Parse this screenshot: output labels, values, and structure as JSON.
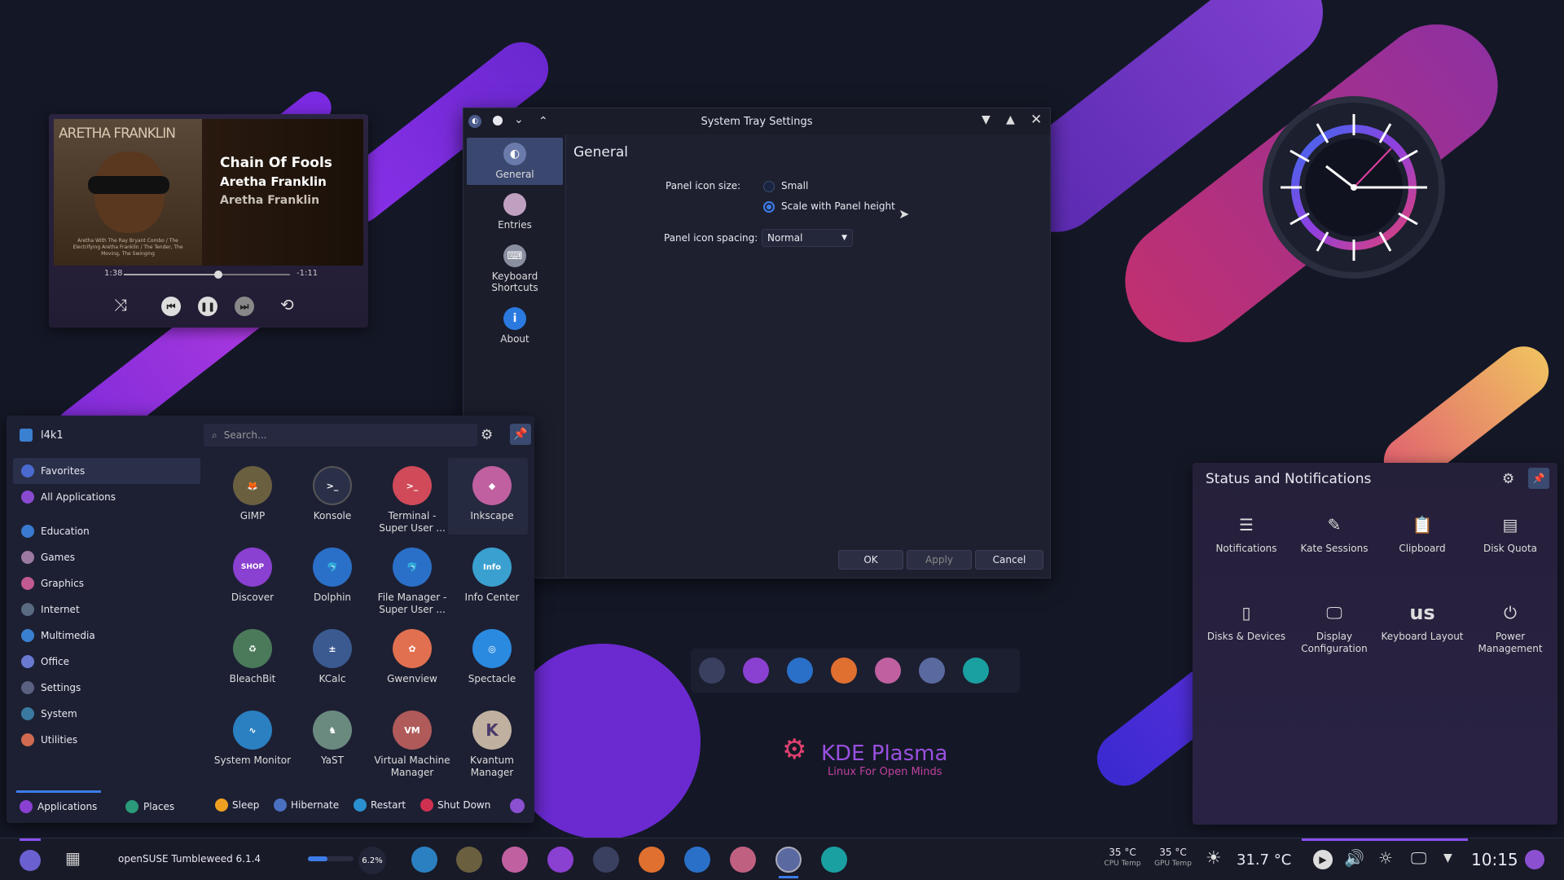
{
  "player": {
    "album_text": "ARETHA FRANKLIN",
    "title": "Chain Of Fools",
    "artist": "Aretha Franklin",
    "album": "Aretha Franklin",
    "elapsed": "1:38",
    "remaining": "-1:11",
    "progress": 0.57,
    "cover_caption": "Aretha With The Ray Bryant Combo / The Electrifying Aretha Franklin / The Tender, The Moving, The Swinging"
  },
  "window": {
    "title": "System Tray Settings",
    "sidebar": [
      {
        "label": "General",
        "icon": "general-icon"
      },
      {
        "label": "Entries",
        "icon": "entries-icon"
      },
      {
        "label": "Keyboard Shortcuts",
        "icon": "keyboard-icon"
      },
      {
        "label": "About",
        "icon": "about-icon"
      }
    ],
    "heading": "General",
    "icon_size_label": "Panel icon size:",
    "icon_size_options": [
      "Small",
      "Scale with Panel height"
    ],
    "icon_size_selected": "Scale with Panel height",
    "spacing_label": "Panel icon spacing:",
    "spacing_value": "Normal",
    "ok": "OK",
    "apply": "Apply",
    "cancel": "Cancel"
  },
  "menu": {
    "user": "l4k1",
    "search_placeholder": "Search...",
    "categories": [
      "Favorites",
      "All Applications",
      "Education",
      "Games",
      "Graphics",
      "Internet",
      "Multimedia",
      "Office",
      "Settings",
      "System",
      "Utilities"
    ],
    "apps": [
      "GIMP",
      "Konsole",
      "Terminal - Super User ...",
      "Inkscape",
      "Discover",
      "Dolphin",
      "File Manager - Super User ...",
      "Info Center",
      "BleachBit",
      "KCalc",
      "Gwenview",
      "Spectacle",
      "System Monitor",
      "YaST",
      "Virtual Machine Manager",
      "Kvantum Manager"
    ],
    "tabs": [
      "Applications",
      "Places"
    ],
    "power": [
      "Sleep",
      "Hibernate",
      "Restart",
      "Shut Down"
    ]
  },
  "notifications": {
    "title": "Status and Notifications",
    "items": [
      "Notifications",
      "Kate Sessions",
      "Clipboard",
      "Disk Quota",
      "Disks & Devices",
      "Display Configuration",
      "Keyboard Layout",
      "Power Management"
    ],
    "keyboard_layout_code": "us"
  },
  "branding": {
    "kde": "KDE Plasma",
    "tagline": "Linux For Open Minds"
  },
  "taskbar": {
    "os": "openSUSE Tumbleweed 6.1.4",
    "cpu_percent": "6.2%",
    "cpu_temp": "35 °C",
    "cpu_temp_label": "CPU Temp",
    "gpu_temp": "35 °C",
    "gpu_temp_label": "GPU Temp",
    "weather": "31.7 °C",
    "clock": "10:15"
  },
  "colors": {
    "accent": "#3d7ce8",
    "purple": "#8a3cf0",
    "pink": "#e0407a"
  }
}
